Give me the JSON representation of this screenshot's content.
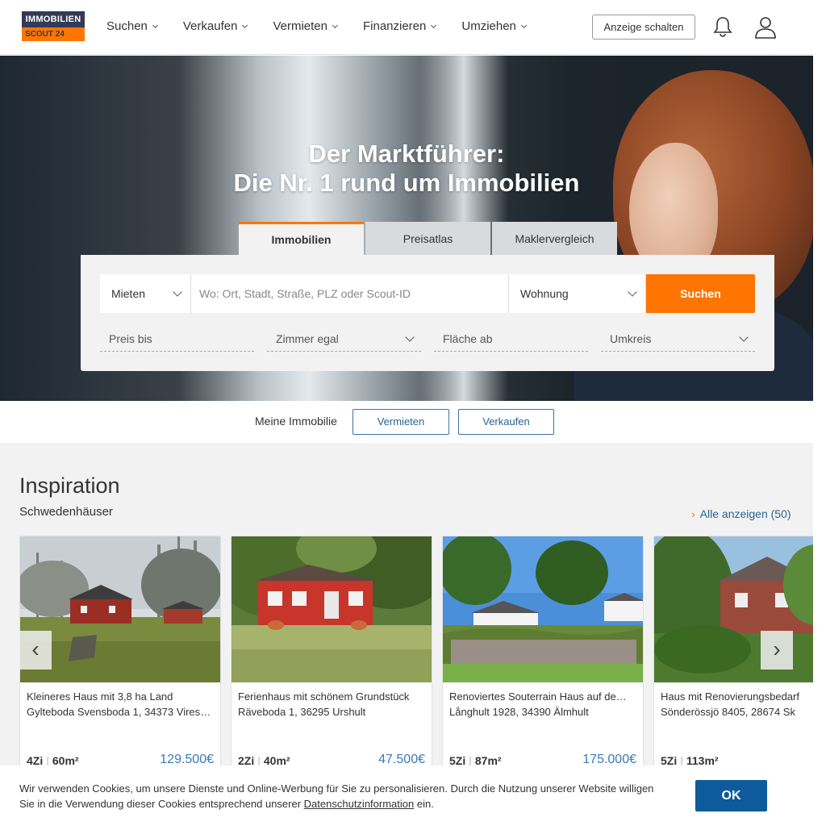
{
  "header": {
    "logo_line1": "IMMOBILIEN",
    "logo_line2": "SCOUT 24",
    "nav": [
      "Suchen",
      "Verkaufen",
      "Vermieten",
      "Finanzieren",
      "Umziehen"
    ],
    "cta_label": "Anzeige schalten",
    "icons": [
      "bell-icon",
      "user-icon"
    ]
  },
  "hero": {
    "title_line1": "Der Marktführer:",
    "title_line2": "Die Nr. 1 rund um Immobilien",
    "tabs": [
      "Immobilien",
      "Preisatlas",
      "Maklervergleich"
    ],
    "active_tab": "Immobilien",
    "search": {
      "type_value": "Mieten",
      "where_placeholder": "Wo: Ort, Stadt, Straße, PLZ oder Scout-ID",
      "property_value": "Wohnung",
      "submit_label": "Suchen"
    },
    "filters": {
      "price": "Preis bis",
      "rooms": "Zimmer egal",
      "area": "Fläche ab",
      "radius": "Umkreis"
    }
  },
  "meine_immobilie": {
    "label": "Meine Immobilie",
    "btn_rent": "Vermieten",
    "btn_sell": "Verkaufen"
  },
  "inspiration": {
    "title": "Inspiration",
    "subtitle": "Schwedenhäuser",
    "see_all": "Alle anzeigen (50)",
    "cards": [
      {
        "title": "Kleineres Haus mit 3,8 ha Land",
        "address": "Gylteboda Svensboda 1, 34373 Vires…",
        "rooms": "4Zi",
        "area": "60m²",
        "price": "129.500€"
      },
      {
        "title": "Ferienhaus mit schönem Grundstück",
        "address": "Räveboda 1, 36295 Urshult",
        "rooms": "2Zi",
        "area": "40m²",
        "price": "47.500€"
      },
      {
        "title": "Renoviertes Souterrain Haus auf de…",
        "address": "Långhult 1928, 34390 Älmhult",
        "rooms": "5Zi",
        "area": "87m²",
        "price": "175.000€"
      },
      {
        "title": "Haus mit Renovierungsbedarf",
        "address": "Sönderössjö 8405, 28674 Sk",
        "rooms": "5Zi",
        "area": "113m²",
        "price": ""
      }
    ]
  },
  "cookie": {
    "text_part1": "Wir verwenden Cookies, um unsere Dienste und Online-Werbung für Sie zu personalisieren. Durch die Nutzung unserer Website willigen Sie in die Verwendung dieser Cookies entsprechend unserer ",
    "link": "Datenschutzinformation",
    "text_part2": " ein.",
    "ok_label": "OK"
  },
  "colors": {
    "accent": "#ff7500",
    "brand_navy": "#333a56",
    "link_blue": "#2a6496",
    "ok_blue": "#0d5b9b"
  }
}
